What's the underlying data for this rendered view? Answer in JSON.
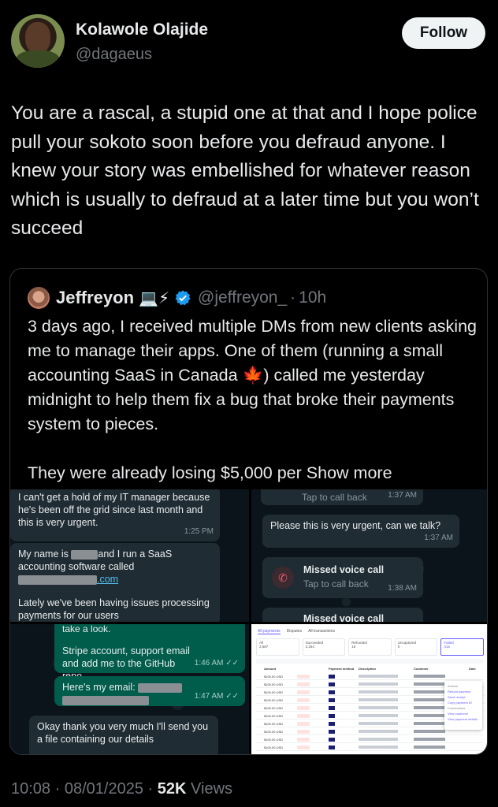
{
  "author": {
    "name": "Kolawole Olajide",
    "handle": "@dagaeus",
    "follow_label": "Follow"
  },
  "tweet": {
    "text": "You are a rascal, a stupid one at that and I hope police pull your sokoto soon before you defraud anyone. I knew your story was embellished for whatever reason which is usually to defraud at a later time but you won’t succeed"
  },
  "quote": {
    "name": "Jeffreyon",
    "name_emoji": "💻⚡",
    "handle": "@jeffreyon_",
    "dot": "·",
    "age": "10h",
    "paragraph1_a": "3 days ago, I received multiple DMs from new clients asking me to manage their apps. One of them (running a small accounting SaaS in Canada ",
    "flag_emoji": "🍁",
    "paragraph1_b": ") called me yesterday midnight to help them fix a bug that broke their payments system to pieces.",
    "paragraph2": "They were already losing $5,000 per",
    "show_more": "Show more",
    "verified_color": "#1d9bf0"
  },
  "media": {
    "top_left": {
      "msg1": "I can't get a hold of my IT manager because he's been off the grid since last month and this is very urgent.",
      "msg1_time": "1:25 PM",
      "msg2_a": "My name is",
      "msg2_b": "and I run a SaaS accounting software called",
      "msg2_com": ".com",
      "msg2_c": "Lately we've been having issues processing payments for our users"
    },
    "top_right": {
      "call_top": "Tap to call back",
      "call_top_time": "1:37 AM",
      "msg": "Please this is very urgent, can we talk?",
      "msg_time": "1:37 AM",
      "missed_title": "Missed voice call",
      "missed_sub": "Tap to call back",
      "missed_time": "1:38 AM",
      "missed_title2": "Missed voice call"
    },
    "bottom_left": {
      "msg1_top": "take a look.",
      "msg1": "Stripe account, support email and add me to the GitHub repo.",
      "msg1_time": "1:46 AM ✓✓",
      "msg2": "Here's my email:",
      "msg2_time": "1:47 AM ✓✓",
      "msg3": "Okay thank you very much I'll send you a file containing our details"
    },
    "bottom_right": {
      "tabs": [
        "All payments",
        "Disputes",
        "All transactions"
      ],
      "stats": [
        {
          "label": "All",
          "value": "2,687"
        },
        {
          "label": "Succeeded",
          "value": "2,264"
        },
        {
          "label": "Refunded",
          "value": "16"
        },
        {
          "label": "Uncaptured",
          "value": "0"
        },
        {
          "label": "Failed",
          "value": "415"
        }
      ],
      "headers": [
        "Amount",
        "Payment method",
        "Description",
        "Customer",
        "Date"
      ],
      "row_amount": "$100.00 USD",
      "menu": [
        "Actions",
        "Refund payment",
        "Send receipt",
        "Copy payment ID",
        "Connections",
        "View customer",
        "View payment details"
      ]
    }
  },
  "footer": {
    "time": "10:08",
    "date": "08/01/2025",
    "views_count": "52K",
    "views_label": "Views",
    "sep": "·"
  }
}
